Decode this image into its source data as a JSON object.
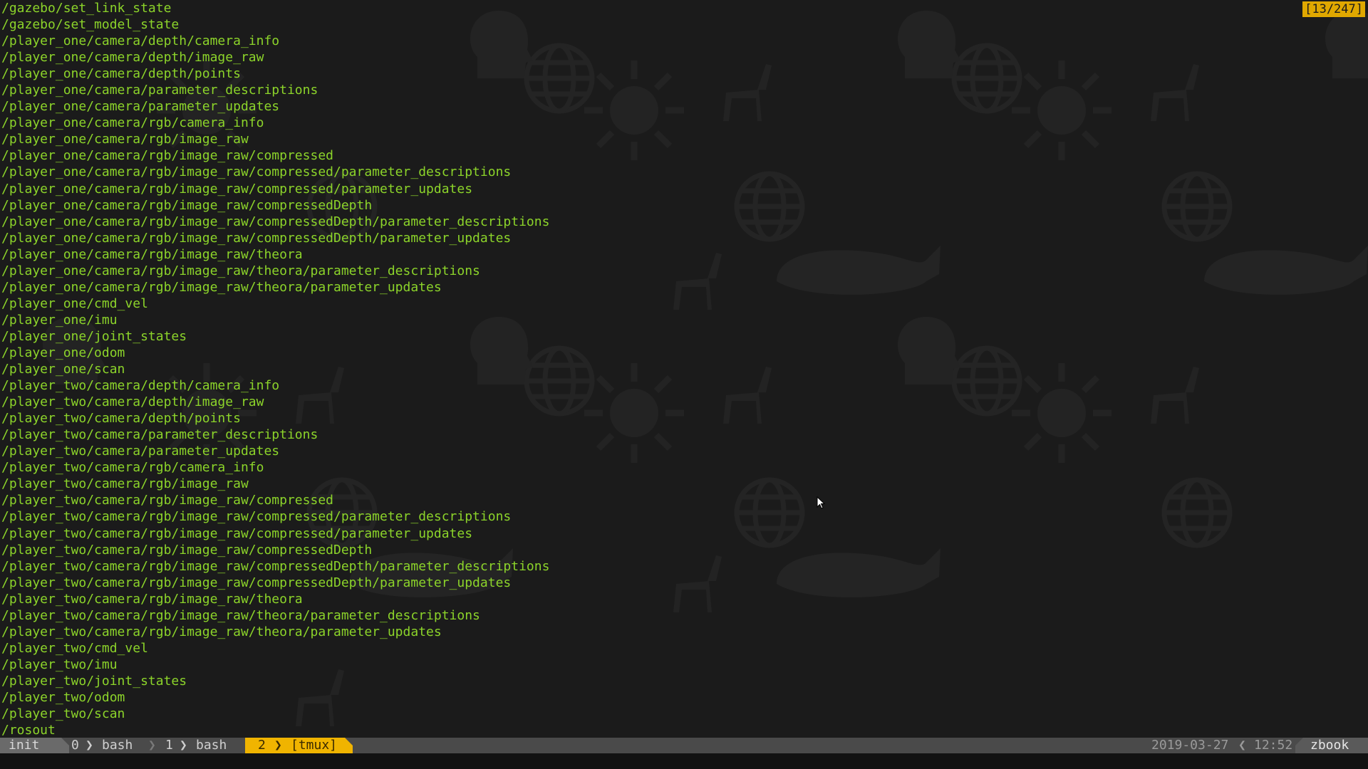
{
  "terminal": {
    "lines": [
      "/gazebo/set_link_state",
      "/gazebo/set_model_state",
      "/player_one/camera/depth/camera_info",
      "/player_one/camera/depth/image_raw",
      "/player_one/camera/depth/points",
      "/player_one/camera/parameter_descriptions",
      "/player_one/camera/parameter_updates",
      "/player_one/camera/rgb/camera_info",
      "/player_one/camera/rgb/image_raw",
      "/player_one/camera/rgb/image_raw/compressed",
      "/player_one/camera/rgb/image_raw/compressed/parameter_descriptions",
      "/player_one/camera/rgb/image_raw/compressed/parameter_updates",
      "/player_one/camera/rgb/image_raw/compressedDepth",
      "/player_one/camera/rgb/image_raw/compressedDepth/parameter_descriptions",
      "/player_one/camera/rgb/image_raw/compressedDepth/parameter_updates",
      "/player_one/camera/rgb/image_raw/theora",
      "/player_one/camera/rgb/image_raw/theora/parameter_descriptions",
      "/player_one/camera/rgb/image_raw/theora/parameter_updates",
      "/player_one/cmd_vel",
      "/player_one/imu",
      "/player_one/joint_states",
      "/player_one/odom",
      "/player_one/scan",
      "/player_two/camera/depth/camera_info",
      "/player_two/camera/depth/image_raw",
      "/player_two/camera/depth/points",
      "/player_two/camera/parameter_descriptions",
      "/player_two/camera/parameter_updates",
      "/player_two/camera/rgb/camera_info",
      "/player_two/camera/rgb/image_raw",
      "/player_two/camera/rgb/image_raw/compressed",
      "/player_two/camera/rgb/image_raw/compressed/parameter_descriptions",
      "/player_two/camera/rgb/image_raw/compressed/parameter_updates",
      "/player_two/camera/rgb/image_raw/compressedDepth",
      "/player_two/camera/rgb/image_raw/compressedDepth/parameter_descriptions",
      "/player_two/camera/rgb/image_raw/compressedDepth/parameter_updates",
      "/player_two/camera/rgb/image_raw/theora",
      "/player_two/camera/rgb/image_raw/theora/parameter_descriptions",
      "/player_two/camera/rgb/image_raw/theora/parameter_updates",
      "/player_two/cmd_vel",
      "/player_two/imu",
      "/player_two/joint_states",
      "/player_two/odom",
      "/player_two/scan",
      "/rosout"
    ],
    "position_indicator": "[13/247]",
    "text_color": "#8cd42a"
  },
  "statusbar": {
    "session": "init",
    "windows": [
      {
        "index": "0",
        "name": "bash"
      },
      {
        "index": "1",
        "name": "bash"
      },
      {
        "index": "2",
        "name": "[tmux]",
        "active": true
      }
    ],
    "date": "2019-03-27",
    "time": "12:52",
    "host": "zbook",
    "accent_color": "#f0b400"
  },
  "wallpaper": {
    "icons": [
      "sun-icon",
      "globe-icon",
      "head-brain-icon",
      "deer-icon",
      "whale-icon",
      "violin-icon",
      "book-icon",
      "leaf-icon"
    ]
  }
}
